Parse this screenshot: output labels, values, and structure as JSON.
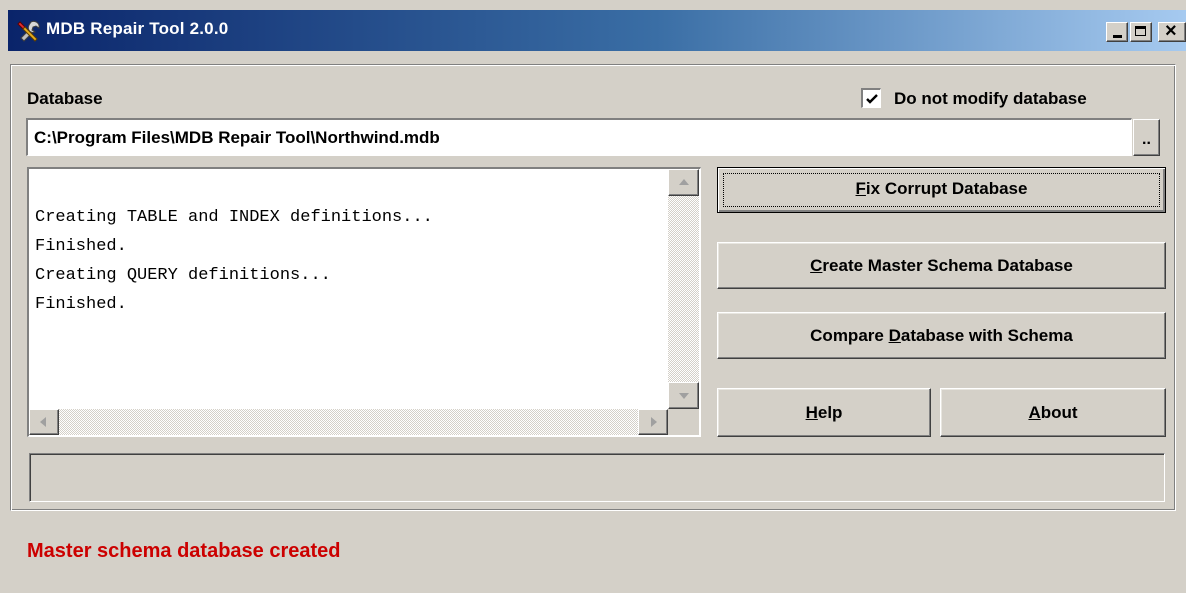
{
  "window": {
    "title": "MDB Repair Tool 2.0.0",
    "icon": "tools-icon",
    "controls": [
      "minimize-icon",
      "maximize-icon",
      "close-icon"
    ]
  },
  "database": {
    "label": "Database",
    "path": "C:\\Program Files\\MDB Repair Tool\\Northwind.mdb",
    "browse_label": ".."
  },
  "options": {
    "no_modify_label": "Do not modify database",
    "no_modify_checked": true
  },
  "log": {
    "text": "Creating TABLE and INDEX definitions...\nFinished.\nCreating QUERY definitions...\nFinished."
  },
  "buttons": {
    "fix": {
      "mnemonic": "F",
      "rest": "ix Corrupt Database"
    },
    "create": {
      "mnemonic": "C",
      "rest": "reate Master Schema Database"
    },
    "compare": {
      "before": "Compare ",
      "mnemonic": "D",
      "rest": "atabase with Schema"
    },
    "help": {
      "mnemonic": "H",
      "rest": "elp"
    },
    "about": {
      "mnemonic": "A",
      "rest": "bout"
    }
  },
  "status": {
    "progress_text": "",
    "message": "Master schema database created",
    "message_color": "#cc0000"
  },
  "colors": {
    "face": "#d4d0c8",
    "title_start": "#0a246a",
    "title_end": "#a6caf0"
  }
}
